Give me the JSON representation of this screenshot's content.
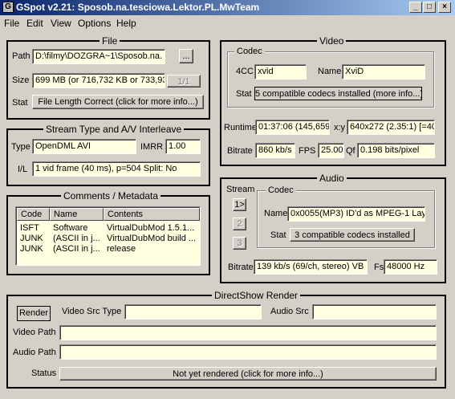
{
  "window": {
    "title": "GSpot v2.21: Sposob.na.tesciowa.Lektor.PL.MwTeam",
    "icon_glyph": "G",
    "minimize_glyph": "_",
    "maximize_glyph": "□",
    "close_glyph": "×"
  },
  "menu": [
    "File",
    "Edit",
    "View",
    "Options",
    "Help"
  ],
  "file": {
    "legend": "File",
    "path_label": "Path",
    "path_value": "D:\\filmy\\DOZGRA~1\\Sposob.na.",
    "browse_label": "...",
    "size_label": "Size",
    "size_value": "699 MB (or 716,732 KB or 733,93",
    "page_label": "1/1",
    "stat_label": "Stat",
    "stat_button": "File Length Correct (click for more info...)"
  },
  "stream": {
    "legend": "Stream Type and A/V Interleave",
    "type_label": "Type",
    "type_value": "OpenDML AVI",
    "imrr_label": "IMRR",
    "imrr_value": "1.00",
    "il_label": "I/L",
    "il_value": "1 vid frame (40 ms), p=504  Split: No"
  },
  "comments": {
    "legend": "Comments / Metadata",
    "columns": [
      "Code",
      "Name",
      "Contents"
    ],
    "rows": [
      [
        "ISFT",
        "Software",
        "VirtualDubMod 1.5.1..."
      ],
      [
        "JUNK",
        "(ASCII in j...",
        "VirtualDubMod build ..."
      ],
      [
        "JUNK",
        "(ASCII in j...",
        "release"
      ]
    ]
  },
  "video": {
    "legend": "Video",
    "codec_legend": "Codec",
    "fourcc_label": "4CC",
    "fourcc_value": "xvid",
    "name_label": "Name",
    "name_value": "XviD",
    "stat_label": "Stat",
    "stat_button": "5 compatible codecs installed (more info...)",
    "runtime_label": "Runtime",
    "runtime_value": "01:37:06 (145,659",
    "xy_label": "x:y",
    "xy_value": "640x272 (2.35:1) [=40",
    "bitrate_label": "Bitrate",
    "bitrate_value": "860 kb/s",
    "fps_label": "FPS",
    "fps_value": "25.00",
    "qf_label": "Qf",
    "qf_value": "0.198 bits/pixel"
  },
  "audio": {
    "legend": "Audio",
    "stream_label": "Stream",
    "streams": [
      "1>",
      "2",
      "3"
    ],
    "codec_legend": "Codec",
    "name_label": "Name",
    "name_value": "0x0055(MP3) ID'd as MPEG-1 Lay",
    "stat_label": "Stat",
    "stat_button": "3 compatible codecs installed",
    "bitrate_label": "Bitrate",
    "bitrate_value": "139 kb/s (69/ch, stereo) VB",
    "fs_label": "Fs",
    "fs_value": "48000 Hz"
  },
  "directshow": {
    "legend": "DirectShow Render",
    "render_button": "Render",
    "video_src_type_label": "Video Src Type",
    "video_src_type_value": "",
    "audio_src_label": "Audio Src",
    "audio_src_value": "",
    "video_path_label": "Video Path",
    "video_path_value": "",
    "audio_path_label": "Audio Path",
    "audio_path_value": "",
    "status_label": "Status",
    "status_button": "Not yet rendered (click for more info...)"
  }
}
